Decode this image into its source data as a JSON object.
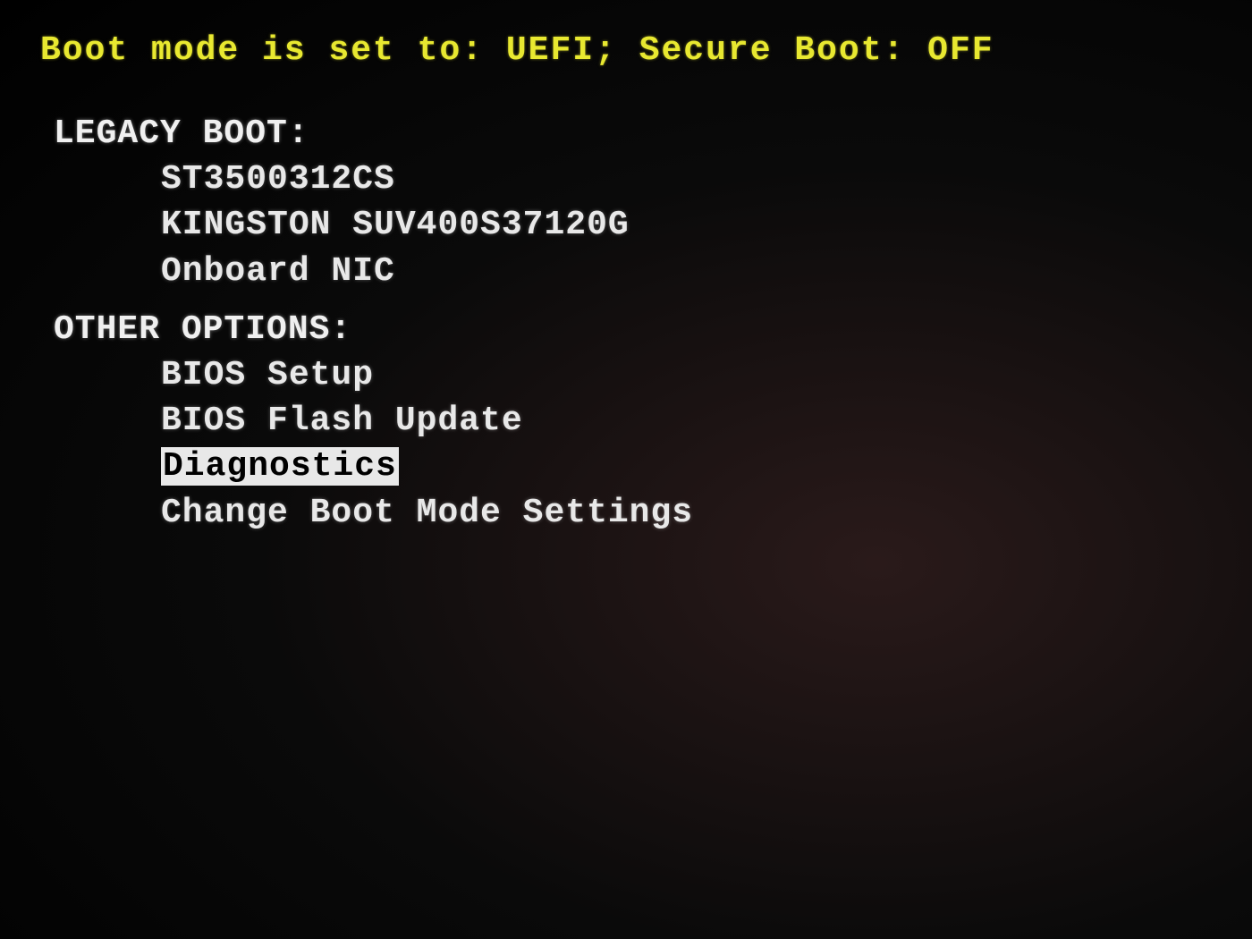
{
  "status_line": "Boot mode is set to: UEFI; Secure Boot: OFF",
  "sections": {
    "legacy_boot": {
      "header": "LEGACY BOOT:",
      "items": [
        "ST3500312CS",
        "KINGSTON SUV400S37120G",
        "Onboard NIC"
      ]
    },
    "other_options": {
      "header": "OTHER OPTIONS:",
      "items": [
        "BIOS Setup",
        "BIOS Flash Update",
        "Diagnostics",
        "Change Boot Mode Settings"
      ],
      "selected_index": 2
    }
  }
}
